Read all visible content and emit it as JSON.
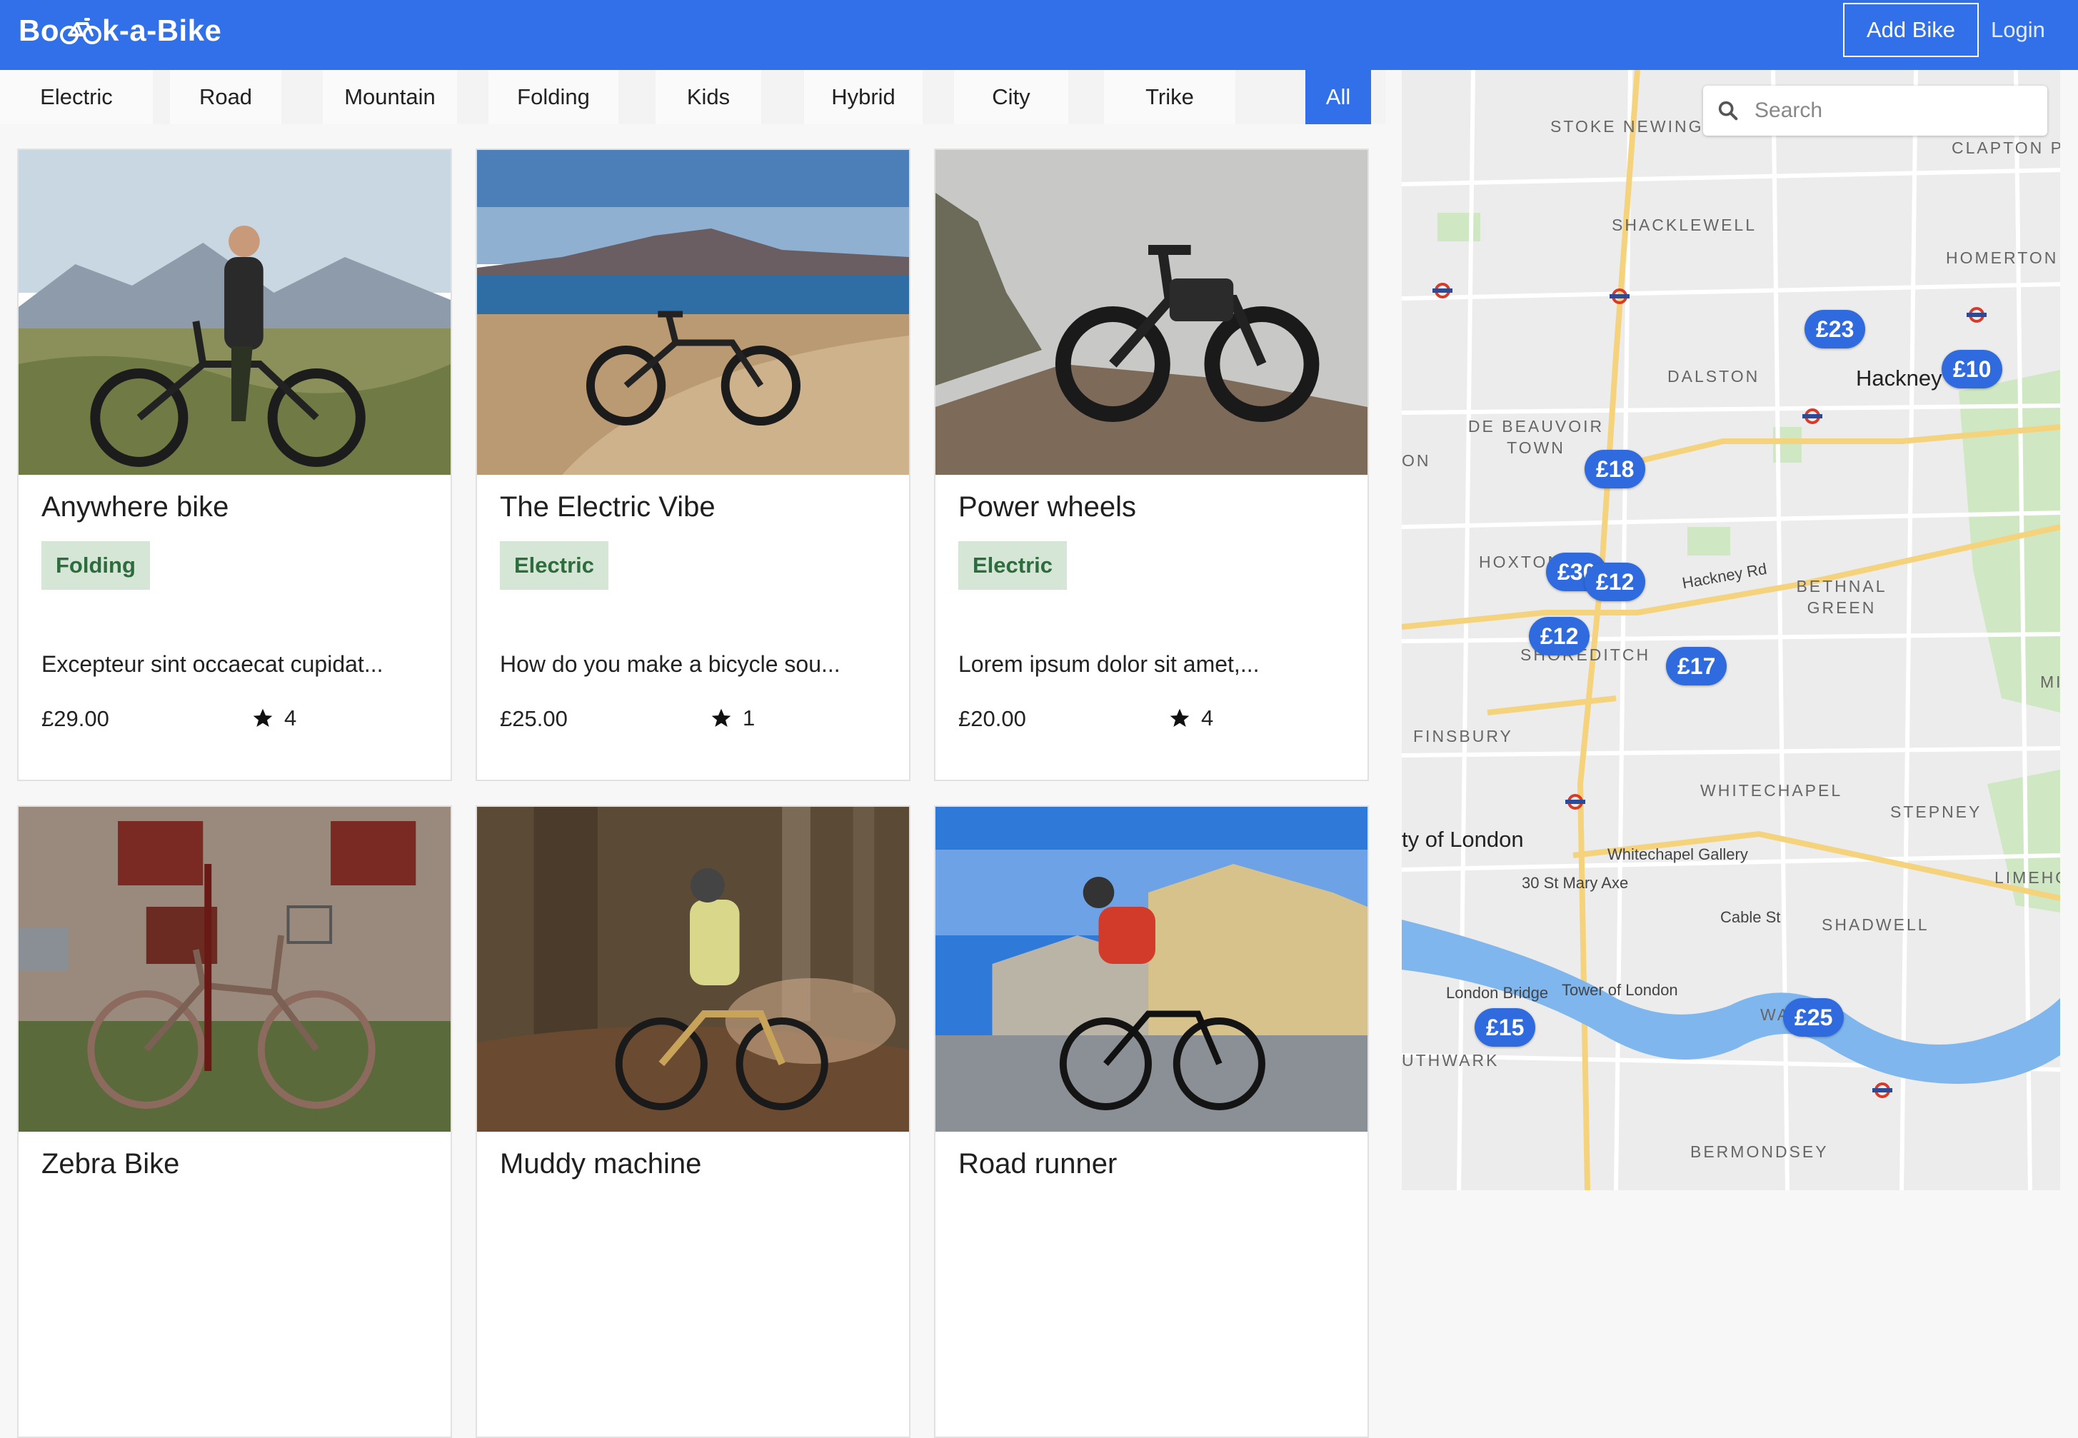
{
  "header": {
    "logo": "Book-a-Bike",
    "add_bike_label": "Add Bike",
    "login_label": "Login",
    "brand_color": "#3170e8"
  },
  "categories": [
    "Electric",
    "Road",
    "Mountain",
    "Folding",
    "Kids",
    "Hybrid",
    "City",
    "Trike",
    "All"
  ],
  "active_category": "All",
  "listings": [
    {
      "title": "Anywhere bike",
      "category": "Folding",
      "description": "Excepteur sint occaecat cupidat...",
      "price": "£29.00",
      "rating": "4"
    },
    {
      "title": "The Electric Vibe",
      "category": "Electric",
      "description": "How do you make a bicycle sou...",
      "price": "£25.00",
      "rating": "1"
    },
    {
      "title": "Power wheels",
      "category": "Electric",
      "description": "Lorem ipsum dolor sit amet,...",
      "price": "£20.00",
      "rating": "4"
    },
    {
      "title": "Zebra Bike"
    },
    {
      "title": "Muddy machine"
    },
    {
      "title": "Road runner"
    }
  ],
  "map": {
    "search_placeholder": "Search",
    "pins": [
      "£23",
      "£10",
      "£18",
      "£30",
      "£12",
      "£12",
      "£17",
      "£25",
      "£15"
    ],
    "labels": {
      "stoke_newington": "STOKE NEWINGTON",
      "clapton_park": "CLAPTON PARK",
      "shacklewell": "SHACKLEWELL",
      "homerton": "HOMERTON",
      "dalston": "DALSTON",
      "hackney": "Hackney",
      "de_beauvoir": "DE BEAUVOIR TOWN",
      "hoxton": "HOXTON",
      "hackney_rd": "Hackney Rd",
      "bethnal_green": "BETHNAL GREEN",
      "shoreditch": "SHOREDITCH",
      "finsbury": "FINSBURY",
      "whitechapel": "WHITECHAPEL",
      "stepney": "STEPNEY",
      "city_of_london": "ty of London",
      "whitechapel_gallery": "Whitechapel Gallery",
      "mary_axe": "30 St Mary Axe",
      "cable_st": "Cable St",
      "shadwell": "SHADWELL",
      "limehouse": "LIMEHO",
      "london_bridge": "London Bridge",
      "tower_of_london": "Tower of London",
      "southwark": "UTHWARK",
      "bermondsey": "BERMONDSEY",
      "mile_end": "MILE",
      "on": "ON",
      "wapping": "WA"
    }
  }
}
